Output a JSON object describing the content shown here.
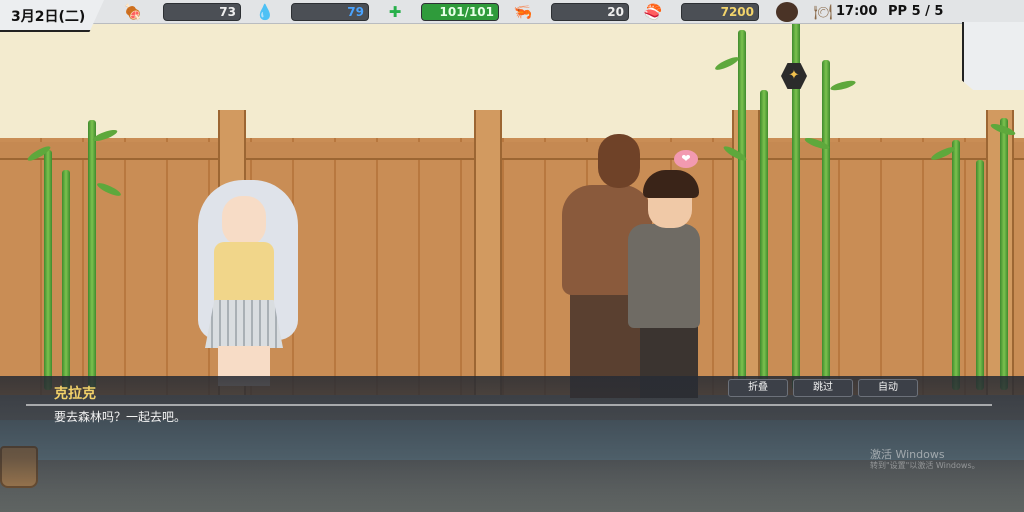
{
  "hud": {
    "date": "3月2日(二)",
    "hunger": {
      "icon": "meat-icon",
      "value": "73",
      "fraction": 0.73,
      "color": "#4b4f55"
    },
    "water": {
      "icon": "water-drop-icon",
      "value": "79",
      "fraction": 0.79,
      "color": "#2f7fd6"
    },
    "health": {
      "icon": "health-cross-icon",
      "value": "101/101",
      "fraction": 1.0,
      "color": "#2f9b3b"
    },
    "food": {
      "icon": "shrimp-icon",
      "value": "20",
      "fraction": 0.2,
      "color": "#4b4f55"
    },
    "money": {
      "icon": "money-icon",
      "value": "7200",
      "color": "#f1d36b"
    },
    "avatar": "avatar-icon",
    "clock_icon": "dish-icon",
    "time": "17:00",
    "pp": "PP 5 / 5"
  },
  "scene": {
    "quest_icon": "bird-icon",
    "affection_icon": "heart-icon"
  },
  "dialog": {
    "speaker": "克拉克",
    "text": "要去森林吗？一起去吧。",
    "buttons": {
      "fold": "折叠",
      "skip": "跳过",
      "auto": "自动"
    }
  },
  "watermark": {
    "line1": "激活 Windows",
    "line2": "转到\"设置\"以激活 Windows。"
  }
}
